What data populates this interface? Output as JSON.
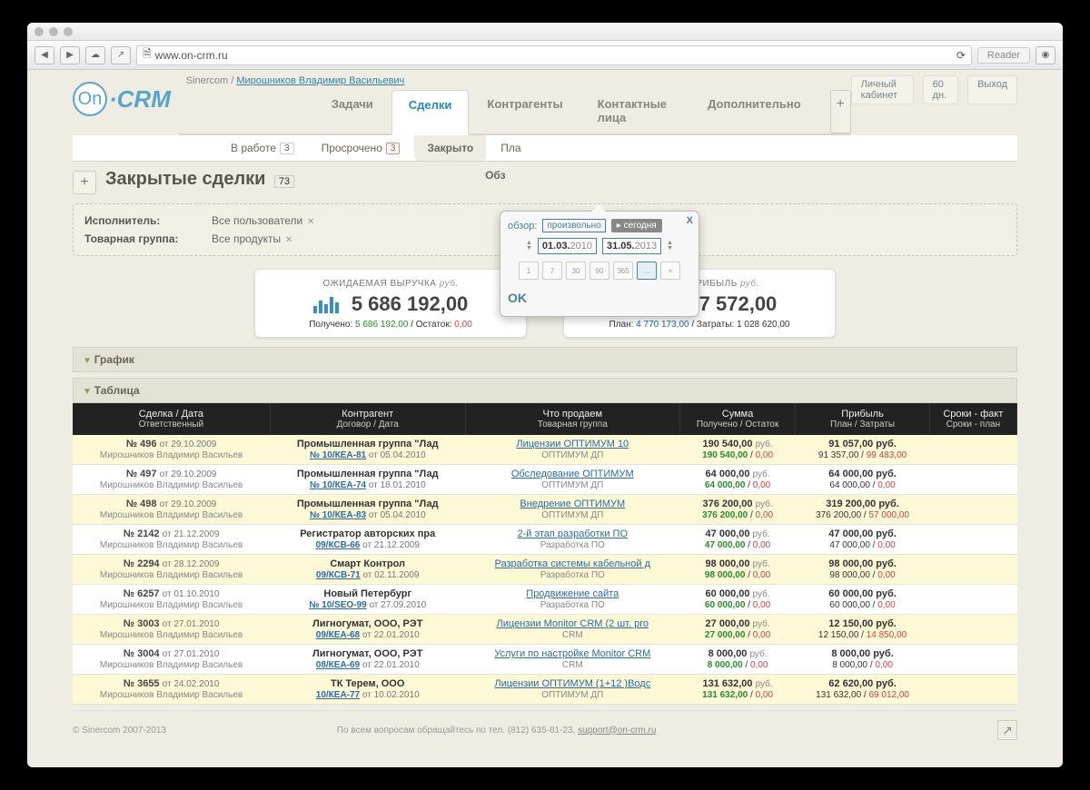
{
  "browser": {
    "url": "www.on-crm.ru",
    "reader": "Reader"
  },
  "breadcrumb": {
    "company": "Sinercom",
    "user": "Мирошников Владимир Васильевич"
  },
  "topright": {
    "cabinet": "Личный кабинет",
    "days": "60 дн.",
    "logout": "Выход"
  },
  "logo": {
    "on": "On",
    "crm": "·CRM"
  },
  "nav": [
    "Задачи",
    "Сделки",
    "Контрагенты",
    "Контактные лица",
    "Дополнительно"
  ],
  "nav_active": 1,
  "subtabs": [
    {
      "label": "В работе",
      "badge": "3"
    },
    {
      "label": "Просрочено",
      "badge": "3",
      "red": true
    },
    {
      "label": "Закрыто",
      "active": true
    },
    {
      "label": "Пла"
    }
  ],
  "title": "Закрытые сделки",
  "title_count": "73",
  "title_cutoff": "Обз",
  "filters": {
    "executor_label": "Исполнитель:",
    "executor_value": "Все пользователи",
    "group_label": "Товарная группа:",
    "group_value": "Все продукты"
  },
  "popover": {
    "label": "обзор:",
    "mode": "произвольно",
    "today": "сегодня",
    "date_from": {
      "d": "01.03.",
      "y": "2010"
    },
    "date_to": {
      "d": "31.05.",
      "y": "2013"
    },
    "presets": [
      "1",
      "7",
      "30",
      "90",
      "365",
      "...",
      "×"
    ],
    "ok": "OK"
  },
  "kpi": {
    "left": {
      "title": "ОЖИДАЕМАЯ ВЫРУЧКА",
      "curr": "руб.",
      "value": "5 686 192,00",
      "sub_l": "Получено:",
      "sub_v1": "5 686 192,00",
      "sub_m": "/ Остаток:",
      "sub_v2": "0,00"
    },
    "right": {
      "title": "ВАЛОВАЯ ПРИБЫЛЬ",
      "curr": "руб.",
      "value": "4 657 572,00",
      "sub_l": "План:",
      "sub_v1": "4 770 173,00",
      "sub_m": "/ Затраты:",
      "sub_v2": "1 028 620,00"
    }
  },
  "sections": {
    "chart": "График",
    "table": "Таблица"
  },
  "thead": {
    "c1a": "Сделка    /    Дата",
    "c1b": "Ответственный",
    "c2a": "Контрагент",
    "c2b": "Договор    /    Дата",
    "c3a": "Что продаем",
    "c3b": "Товарная группа",
    "c4a": "Сумма",
    "c4b": "Получено  /  Остаток",
    "c5a": "Прибыль",
    "c5b": "План  /  Затраты",
    "c6a": "Сроки - факт",
    "c6b": "Сроки - план"
  },
  "rows": [
    {
      "cls": "yl",
      "no": "№ 496",
      "dd": "29.10.2009",
      "resp": "Мирошников Владимир Васильев",
      "cpty": "Промышленная группа \"Лад",
      "ctr": "№ 10/КЕА-81",
      "cdd": "05.04.2010",
      "prod": "Лицензии ОПТИМУМ 10",
      "grp": "ОПТИМУМ ДП",
      "sum": "190 540,00",
      "rec": "190 540,00",
      "rest": "0,00",
      "prof": "91 057,00",
      "plan": "91 357,00",
      "cost": "99 483,00"
    },
    {
      "cls": "wt",
      "no": "№ 497",
      "dd": "29.10.2009",
      "resp": "Мирошников Владимир Васильев",
      "cpty": "Промышленная группа \"Лад",
      "ctr": "№ 10/КЕА-74",
      "cdd": "18.01.2010",
      "prod": "Обследование ОПТИМУМ",
      "grp": "ОПТИМУМ ДП",
      "sum": "64 000,00",
      "rec": "64 000,00",
      "rest": "0,00",
      "prof": "64 000,00",
      "plan": "64 000,00",
      "cost": "0,00"
    },
    {
      "cls": "yl",
      "no": "№ 498",
      "dd": "29.10.2009",
      "resp": "Мирошников Владимир Васильев",
      "cpty": "Промышленная группа \"Лад",
      "ctr": "№ 10/КЕА-83",
      "cdd": "05.04.2010",
      "prod": "Внедрение ОПТИМУМ",
      "grp": "ОПТИМУМ ДП",
      "sum": "376 200,00",
      "rec": "376 200,00",
      "rest": "0,00",
      "prof": "319 200,00",
      "plan": "376 200,00",
      "cost": "57 000,00"
    },
    {
      "cls": "wt",
      "no": "№ 2142",
      "dd": "21.12.2009",
      "resp": "Мирошников Владимир Васильев",
      "cpty": "Регистратор авторских пра",
      "ctr": "09/КСВ-66",
      "cdd": "21.12.2009",
      "prod": "2-й этап разработки ПО",
      "grp": "Разработка ПО",
      "sum": "47 000,00",
      "rec": "47 000,00",
      "rest": "0,00",
      "prof": "47 000,00",
      "plan": "47 000,00",
      "cost": "0,00"
    },
    {
      "cls": "yl",
      "no": "№ 2294",
      "dd": "28.12.2009",
      "resp": "Мирошников Владимир Васильев",
      "cpty": "Смарт Контрол",
      "ctr": "09/КСВ-71",
      "cdd": "02.11.2009",
      "prod": "Разработка системы кабельной д",
      "grp": "Разработка ПО",
      "sum": "98 000,00",
      "rec": "98 000,00",
      "rest": "0,00",
      "prof": "98 000,00",
      "plan": "98 000,00",
      "cost": "0,00"
    },
    {
      "cls": "wt",
      "no": "№ 6257",
      "dd": "01.10.2010",
      "resp": "Мирошников Владимир Васильев",
      "cpty": "Новый Петербург",
      "ctr": "№ 10/SEO-99",
      "cdd": "27.09.2010",
      "prod": "Продвижение сайта",
      "grp": "Разработка ПО",
      "sum": "60 000,00",
      "rec": "60 000,00",
      "rest": "0,00",
      "prof": "60 000,00",
      "plan": "60 000,00",
      "cost": "0,00"
    },
    {
      "cls": "yl",
      "no": "№ 3003",
      "dd": "27.01.2010",
      "resp": "Мирошников Владимир Васильев",
      "cpty": "Лигногумат, ООО, РЭТ",
      "ctr": "09/КЕА-68",
      "cdd": "22.01.2010",
      "prod": "Лицензии Monitor CRM (2 шт. pro",
      "grp": "CRM",
      "sum": "27 000,00",
      "rec": "27 000,00",
      "rest": "0,00",
      "prof": "12 150,00",
      "plan": "12 150,00",
      "cost": "14 850,00"
    },
    {
      "cls": "wt",
      "no": "№ 3004",
      "dd": "27.01.2010",
      "resp": "Мирошников Владимир Васильев",
      "cpty": "Лигногумат, ООО, РЭТ",
      "ctr": "08/КЕА-69",
      "cdd": "22.01.2010",
      "prod": "Услуги по настройке Monitor CRM",
      "grp": "CRM",
      "sum": "8 000,00",
      "rec": "8 000,00",
      "rest": "0,00",
      "prof": "8 000,00",
      "plan": "8 000,00",
      "cost": "0,00"
    },
    {
      "cls": "yl",
      "no": "№ 3655",
      "dd": "24.02.2010",
      "resp": "Мирошников Владимир Васильев",
      "cpty": "ТК Терем, ООО",
      "ctr": "10/КЕА-77",
      "cdd": "10.02.2010",
      "prod": "Лицензии ОПТИМУМ (1+12 )Водс",
      "grp": "ОПТИМУМ ДП",
      "sum": "131 632,00",
      "rec": "131 632,00",
      "rest": "0,00",
      "prof": "62 620,00",
      "plan": "131 632,00",
      "cost": "69 012,00"
    }
  ],
  "footer": {
    "copy": "© Sinercom 2007-2013",
    "text": "По всем вопросам обращайтесь по тел. (812) 635-81-23, ",
    "email": "support@on-crm.ru"
  },
  "misc": {
    "rub": "руб.",
    "ot": "от",
    "slash": " / "
  }
}
